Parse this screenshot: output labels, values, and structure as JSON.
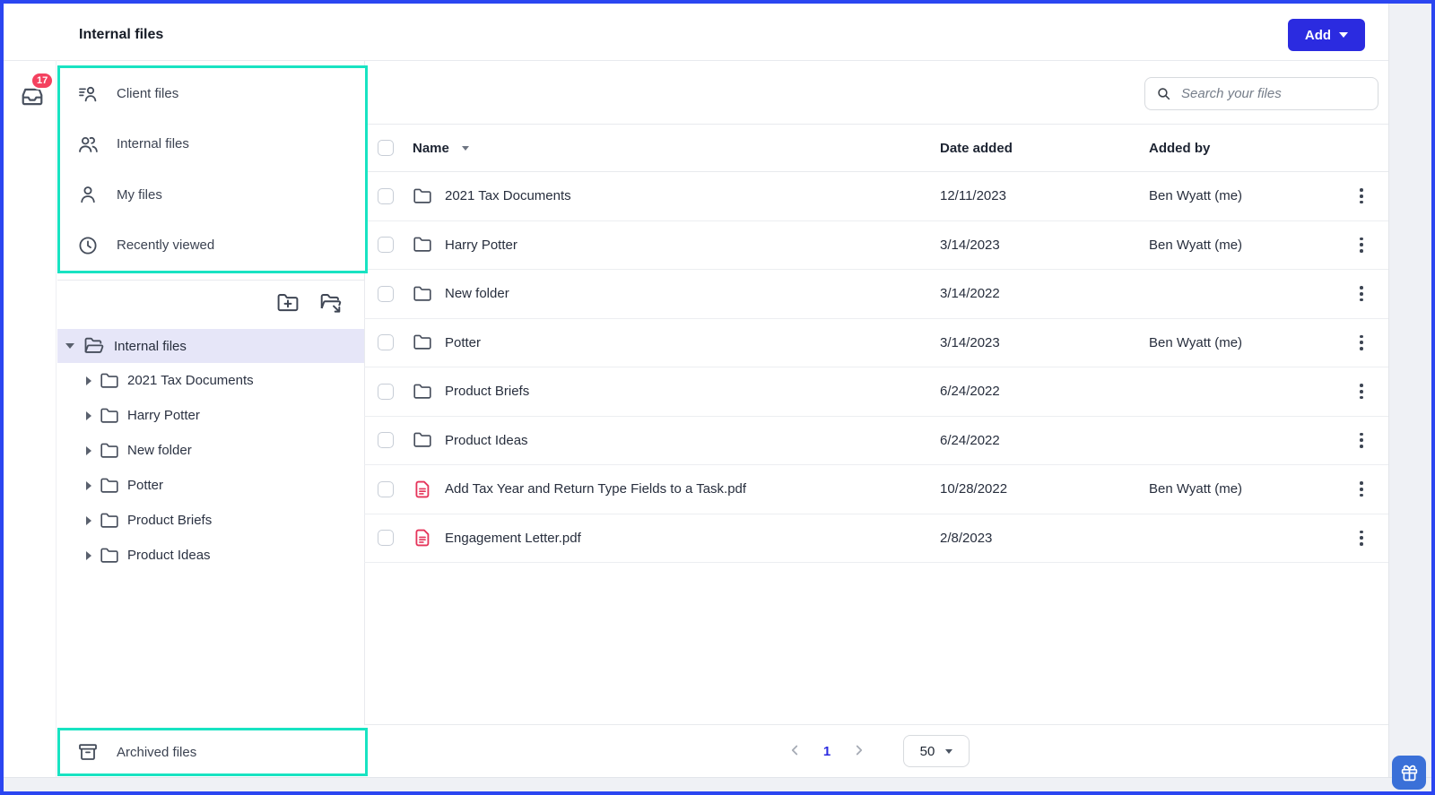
{
  "header": {
    "title": "Internal files",
    "add_label": "Add"
  },
  "notifications": {
    "badge": "17"
  },
  "sidebar": {
    "nav": [
      {
        "label": "Client files",
        "icon": "client-files-icon"
      },
      {
        "label": "Internal files",
        "icon": "internal-files-icon"
      },
      {
        "label": "My files",
        "icon": "my-files-icon"
      },
      {
        "label": "Recently viewed",
        "icon": "clock-icon"
      }
    ],
    "tree": {
      "root": "Internal files",
      "children": [
        "2021 Tax Documents",
        "Harry Potter",
        "New folder",
        "Potter",
        "Product Briefs",
        "Product Ideas"
      ]
    },
    "archived_label": "Archived files"
  },
  "search": {
    "placeholder": "Search your files"
  },
  "table": {
    "columns": [
      "Name",
      "Date added",
      "Added by"
    ],
    "rows": [
      {
        "name": "2021 Tax Documents",
        "type": "folder",
        "date_added": "12/11/2023",
        "added_by": "Ben Wyatt (me)"
      },
      {
        "name": "Harry Potter",
        "type": "folder",
        "date_added": "3/14/2023",
        "added_by": "Ben Wyatt (me)"
      },
      {
        "name": "New folder",
        "type": "folder",
        "date_added": "3/14/2022",
        "added_by": ""
      },
      {
        "name": "Potter",
        "type": "folder",
        "date_added": "3/14/2023",
        "added_by": "Ben Wyatt (me)"
      },
      {
        "name": "Product Briefs",
        "type": "folder",
        "date_added": "6/24/2022",
        "added_by": ""
      },
      {
        "name": "Product Ideas",
        "type": "folder",
        "date_added": "6/24/2022",
        "added_by": ""
      },
      {
        "name": "Add Tax Year and Return Type Fields to a Task.pdf",
        "type": "pdf",
        "date_added": "10/28/2022",
        "added_by": "Ben Wyatt (me)"
      },
      {
        "name": "Engagement Letter.pdf",
        "type": "pdf",
        "date_added": "2/8/2023",
        "added_by": ""
      }
    ]
  },
  "pagination": {
    "page": "1",
    "page_size": "50"
  },
  "colors": {
    "accent_blue": "#2b2be0",
    "frame_blue": "#2b46f1",
    "annotation_teal": "#18e3c2",
    "badge_red": "#f4415f",
    "pdf_red": "#e5345a",
    "selected_row": "#e6e6f8",
    "gift_button_blue": "#3a70d8"
  }
}
